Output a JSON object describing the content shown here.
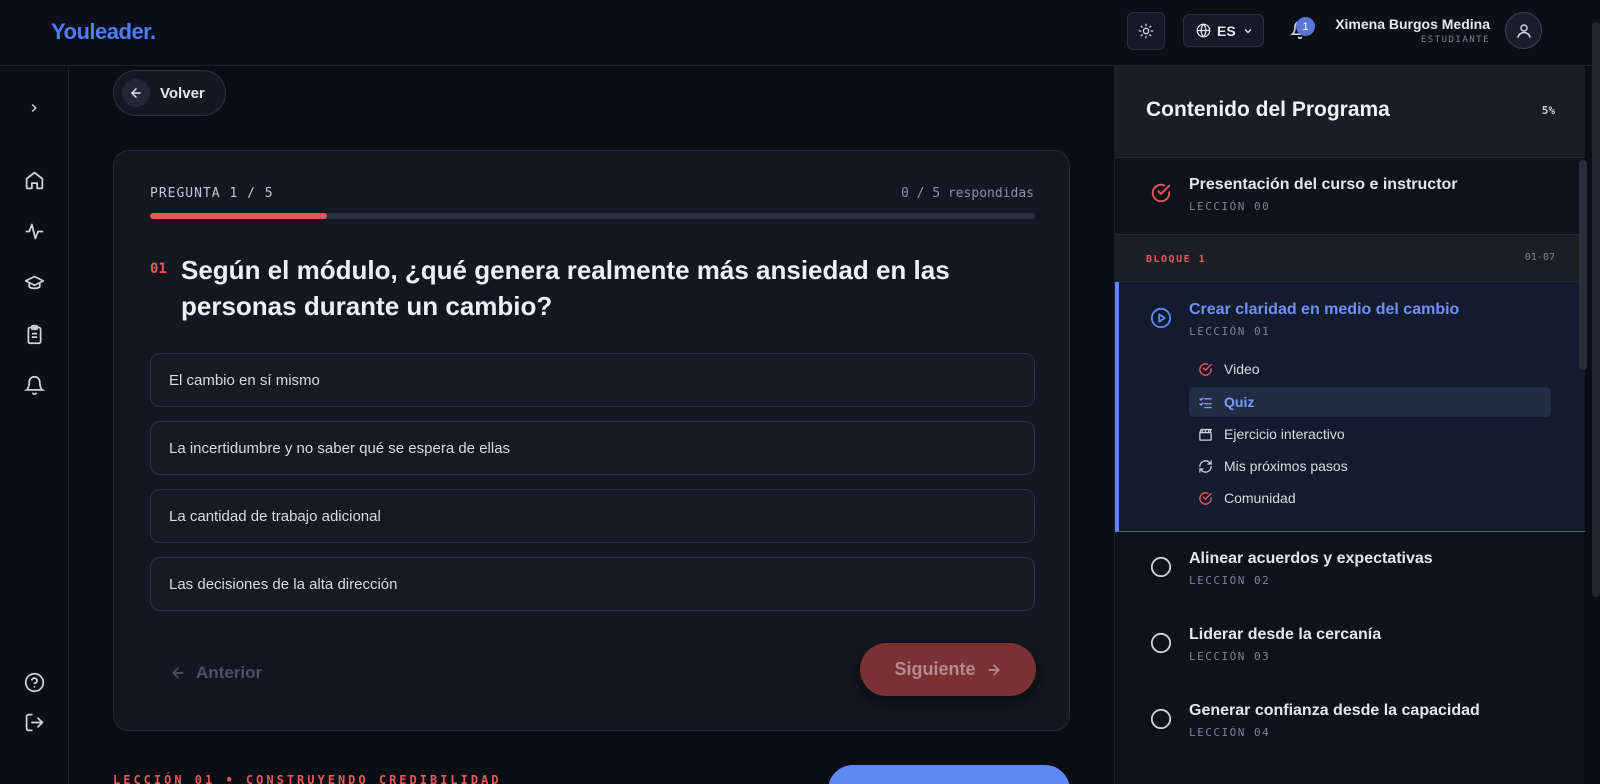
{
  "header": {
    "logo": "Youleader.",
    "lang": "ES",
    "notifications_count": "1",
    "user_name": "Ximena Burgos Medina",
    "user_role": "ESTUDIANTE"
  },
  "nav": {
    "back_label": "Volver"
  },
  "quiz": {
    "question_counter": "PREGUNTA 1 / 5",
    "answered": "0 / 5 respondidas",
    "progress": 0.2,
    "question_number": "01",
    "question_text": "Según el módulo, ¿qué genera realmente más ansiedad en las personas durante un cambio?",
    "options": [
      "El cambio en sí mismo",
      "La incertidumbre y no saber qué se espera de ellas",
      "La cantidad de trabajo adicional",
      "Las decisiones de la alta dirección"
    ],
    "prev_label": "Anterior",
    "next_label": "Siguiente"
  },
  "footer": {
    "lesson_label": "LECCIÓN 01 • CONSTRUYENDO CREDIBILIDAD"
  },
  "panel": {
    "title": "Contenido del Programa",
    "percent": "5%",
    "intro_lesson": {
      "title": "Presentación del curso e instructor",
      "sub": "LECCIÓN 00",
      "status": "completed"
    },
    "block": {
      "label": "BLOQUE 1",
      "range": "01-07"
    },
    "active_lesson": {
      "title": "Crear claridad en medio del cambio",
      "sub": "LECCIÓN 01",
      "items": [
        {
          "label": "Video",
          "icon": "check-circle-icon"
        },
        {
          "label": "Quiz",
          "icon": "list-check-icon"
        },
        {
          "label": "Ejercicio interactivo",
          "icon": "clapperboard-icon"
        },
        {
          "label": "Mis próximos pasos",
          "icon": "refresh-icon"
        },
        {
          "label": "Comunidad",
          "icon": "check-circle-icon"
        }
      ]
    },
    "lessons": [
      {
        "title": "Alinear acuerdos y expectativas",
        "sub": "LECCIÓN 02"
      },
      {
        "title": "Liderar desde la cercanía",
        "sub": "LECCIÓN 03"
      },
      {
        "title": "Generar confianza desde la capacidad",
        "sub": "LECCIÓN 04"
      }
    ]
  },
  "colors": {
    "accent_red": "#e65858",
    "accent_blue": "#5f87f5",
    "background": "#0b0d14"
  }
}
